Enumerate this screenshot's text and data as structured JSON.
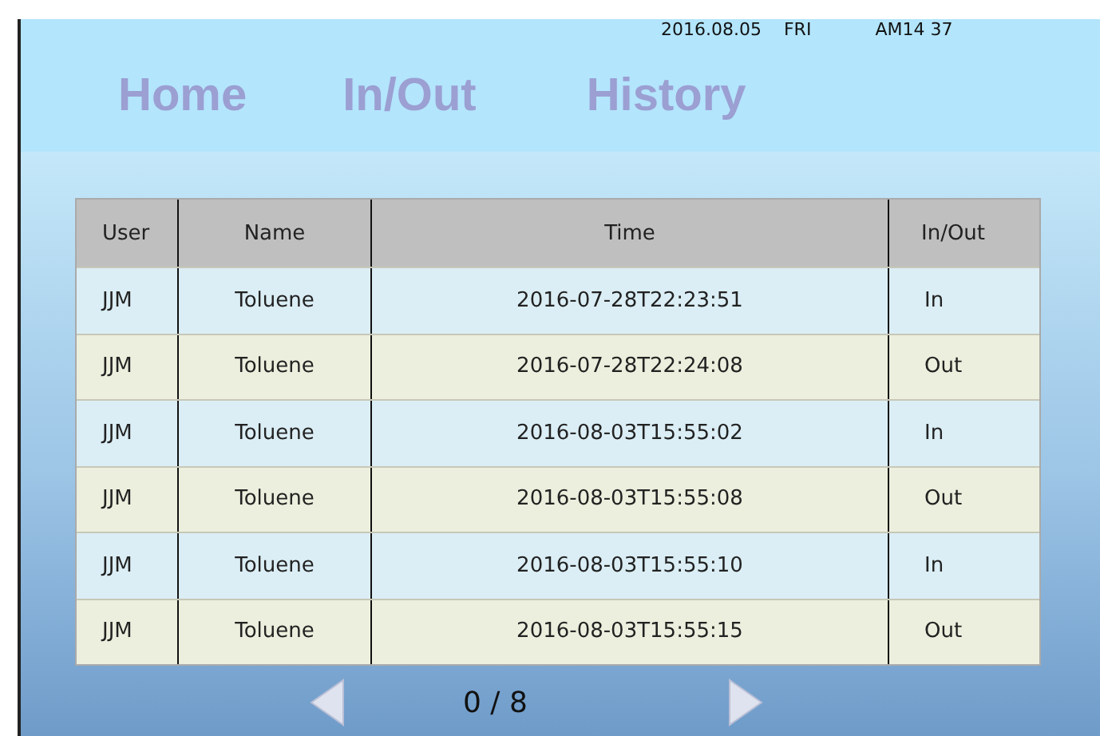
{
  "status": {
    "date": "2016.08.05",
    "weekday": "FRI",
    "time": "AM14 37"
  },
  "nav": [
    "Home",
    "In/Out",
    "History"
  ],
  "table": {
    "columns": [
      "User",
      "Name",
      "Time",
      "In/Out"
    ],
    "rows": [
      [
        "JJM",
        "Toluene",
        "2016-07-28T22:23:51",
        "In"
      ],
      [
        "JJM",
        "Toluene",
        "2016-07-28T22:24:08",
        "Out"
      ],
      [
        "JJM",
        "Toluene",
        "2016-08-03T15:55:02",
        "In"
      ],
      [
        "JJM",
        "Toluene",
        "2016-08-03T15:55:08",
        "Out"
      ],
      [
        "JJM",
        "Toluene",
        "2016-08-03T15:55:10",
        "In"
      ],
      [
        "JJM",
        "Toluene",
        "2016-08-03T15:55:15",
        "Out"
      ]
    ]
  },
  "pager": {
    "page": "0 / 8"
  }
}
